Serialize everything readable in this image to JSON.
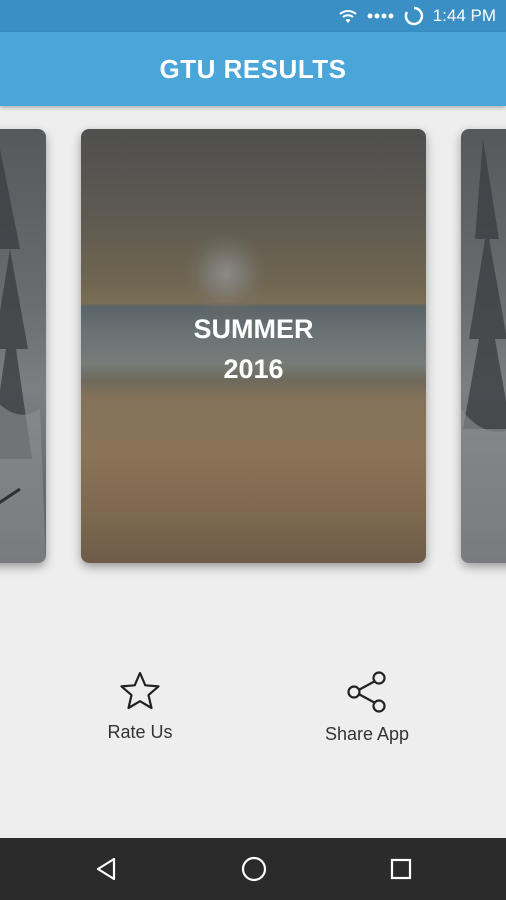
{
  "status_bar": {
    "time": "1:44 PM",
    "icons": [
      "wifi-icon",
      "signal-dots-icon",
      "loading-icon"
    ]
  },
  "app_bar": {
    "title": "GTU RESULTS"
  },
  "carousel": {
    "current_card": {
      "line1": "SUMMER",
      "line2": "2016",
      "background": "beach-sunset"
    },
    "side_cards": [
      "snowy-forest",
      "snowy-forest"
    ]
  },
  "actions": {
    "rate_label": "Rate Us",
    "rate_icon": "star-icon",
    "share_label": "Share App",
    "share_icon": "share-icon"
  },
  "nav_bar": {
    "icons": [
      "back-icon",
      "home-icon",
      "recent-apps-icon"
    ]
  },
  "colors": {
    "status_bar": "#3a90c4",
    "app_bar": "#4aa6d8",
    "background": "#eeeeee",
    "nav_bar": "#2b2b2b"
  }
}
